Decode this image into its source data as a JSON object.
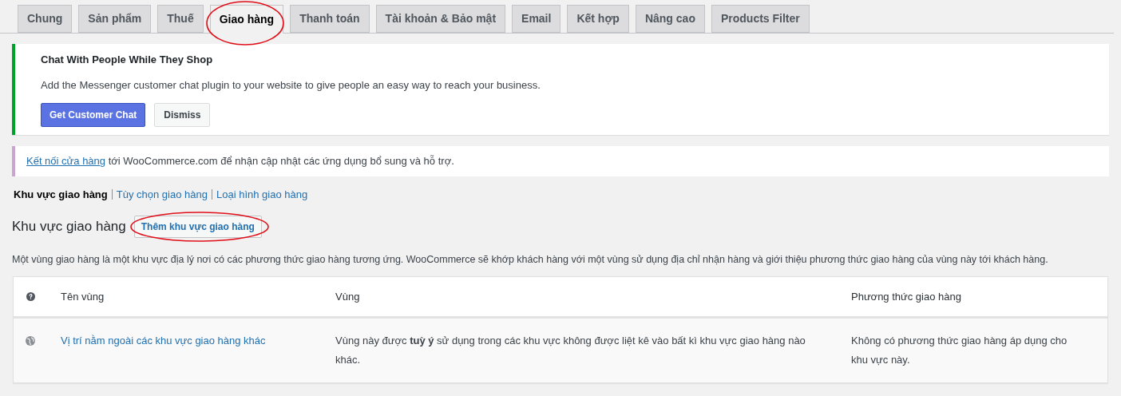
{
  "tabs": [
    {
      "label": "Chung",
      "selected": false
    },
    {
      "label": "Sản phẩm",
      "selected": false
    },
    {
      "label": "Thuế",
      "selected": false
    },
    {
      "label": "Giao hàng",
      "selected": true
    },
    {
      "label": "Thanh toán",
      "selected": false
    },
    {
      "label": "Tài khoản & Bảo mật",
      "selected": false
    },
    {
      "label": "Email",
      "selected": false
    },
    {
      "label": "Kết hợp",
      "selected": false
    },
    {
      "label": "Nâng cao",
      "selected": false
    },
    {
      "label": "Products Filter",
      "selected": false
    }
  ],
  "chat_notice": {
    "title": "Chat With People While They Shop",
    "text": "Add the Messenger customer chat plugin to your website to give people an easy way to reach your business.",
    "primary_button": "Get Customer Chat",
    "secondary_button": "Dismiss"
  },
  "connect_notice": {
    "link": "Kết nối cửa hàng",
    "text": "tới WooCommerce.com để nhận cập nhật các ứng dụng bổ sung và hỗ trợ."
  },
  "subnav": [
    {
      "label": "Khu vực giao hàng",
      "selected": true
    },
    {
      "label": "Tùy chọn giao hàng",
      "selected": false
    },
    {
      "label": "Loại hình giao hàng",
      "selected": false
    }
  ],
  "section": {
    "heading": "Khu vực giao hàng",
    "add_button": "Thêm khu vực giao hàng",
    "description": "Một vùng giao hàng là một khu vực địa lý nơi có các phương thức giao hàng tương ứng. WooCommerce sẽ khớp khách hàng với một vùng sử dụng địa chỉ nhận hàng và giới thiệu phương thức giao hàng của vùng này tới khách hàng."
  },
  "table": {
    "columns": [
      "Tên vùng",
      "Vùng",
      "Phương thức giao hàng"
    ],
    "rows": [
      {
        "name": "Vị trí nằm ngoài các khu vực giao hàng khác",
        "region": "Vùng này được **tuỳ ý** sử dụng trong các khu vực không được liệt kê vào bất kì khu vực giao hàng nào khác.",
        "methods": "Không có phương thức giao hàng áp dụng cho khu vực này."
      }
    ]
  }
}
